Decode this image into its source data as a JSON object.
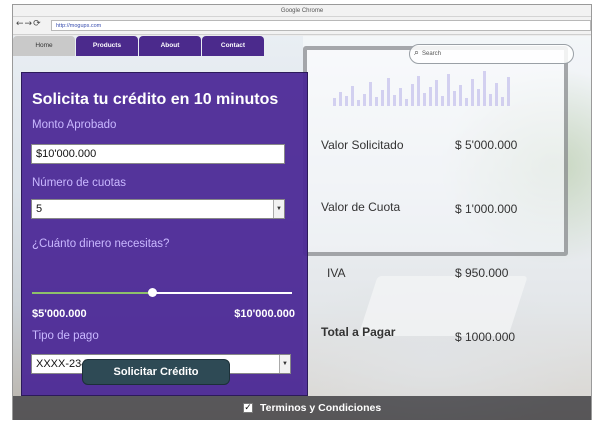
{
  "browser": {
    "title": "Google Chrome",
    "nav_icons": "←→⟳",
    "url": "http://mogups.com"
  },
  "nav": {
    "tabs": [
      {
        "label": "Home"
      },
      {
        "label": "Products"
      },
      {
        "label": "About"
      },
      {
        "label": "Contact"
      }
    ]
  },
  "search": {
    "placeholder": "Search",
    "icon": "magnifier-icon"
  },
  "form": {
    "title": "Solicita tu crédito en 10 minutos",
    "amount_label": "Monto Aprobado",
    "amount_value": "$10'000.000",
    "installments_label": "Número de cuotas",
    "installments_value": "5",
    "question_label": "¿Cuánto dinero necesitas?",
    "slider_min": "$5'000.000",
    "slider_max": "$10'000.000",
    "slider_fraction": 0.46,
    "payment_label": "Tipo de pago",
    "payment_value": "XXXX-2340",
    "submit_label": "Solicitar Crédito"
  },
  "summary": {
    "rows": [
      {
        "label": "Valor Solicitado",
        "value": "$ 5'000.000"
      },
      {
        "label": "Valor de Cuota",
        "value": "$ 1'000.000"
      },
      {
        "label": "IVA",
        "value": "$ 950.000"
      },
      {
        "label": "Total a Pagar",
        "value": "$ 1000.000"
      }
    ]
  },
  "terms": {
    "label": "Terminos y Condiciones",
    "checked": true,
    "check_glyph": "✓"
  },
  "colors": {
    "panel": "#4b2896",
    "tab": "#4b2a8c",
    "button": "#2e4a55",
    "label": "#c9b8ff",
    "slider_fill": "#8ec06a"
  }
}
